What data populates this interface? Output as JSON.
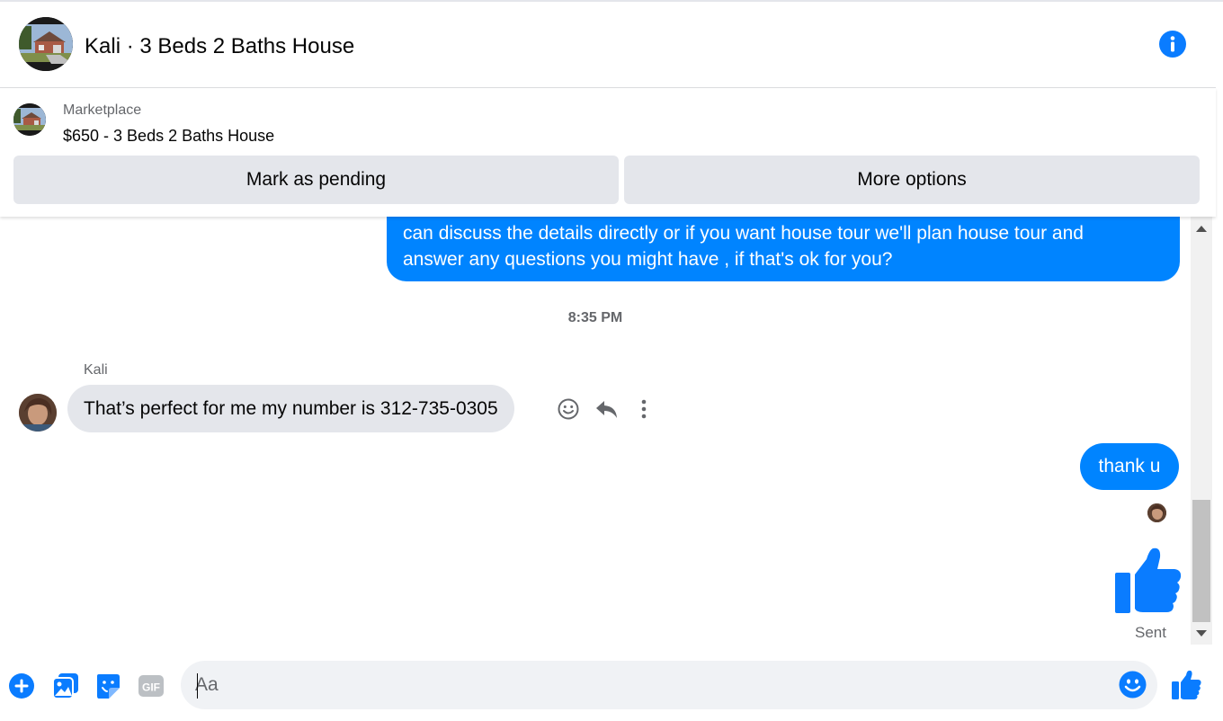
{
  "colors": {
    "accent": "#0084ff",
    "icon_blue": "#0a7cff",
    "bubble_in": "#e4e6eb",
    "muted_text": "#65676b"
  },
  "header": {
    "title": "Kali · 3 Beds 2 Baths House",
    "avatar_icon": "house-photo",
    "info_icon": "info-icon"
  },
  "marketplace": {
    "label": "Marketplace",
    "item": "$650 - 3 Beds 2 Baths House",
    "thumb_icon": "house-photo",
    "mark_pending_label": "Mark as pending",
    "more_options_label": "More options"
  },
  "thread": {
    "outgoing_long_lines": [
      "can discuss the details directly or if you  want house tour we'll plan house tour and",
      "answer any questions you might have , if that's ok for you?"
    ],
    "timestamp": "8:35 PM",
    "sender_name": "Kali",
    "incoming_message": "That’s perfect for me my number is 312-735-0305",
    "message_actions": [
      "react-icon",
      "reply-icon",
      "more-icon"
    ],
    "outgoing_short": "thank u",
    "big_like_icon": "thumbs-up-icon",
    "status": "Sent"
  },
  "composer": {
    "placeholder": "Aa",
    "value": "",
    "icons": [
      "plus-icon",
      "image-icon",
      "sticker-icon",
      "gif-icon",
      "emoji-icon",
      "thumbs-up-icon"
    ],
    "gif_label": "GIF"
  }
}
